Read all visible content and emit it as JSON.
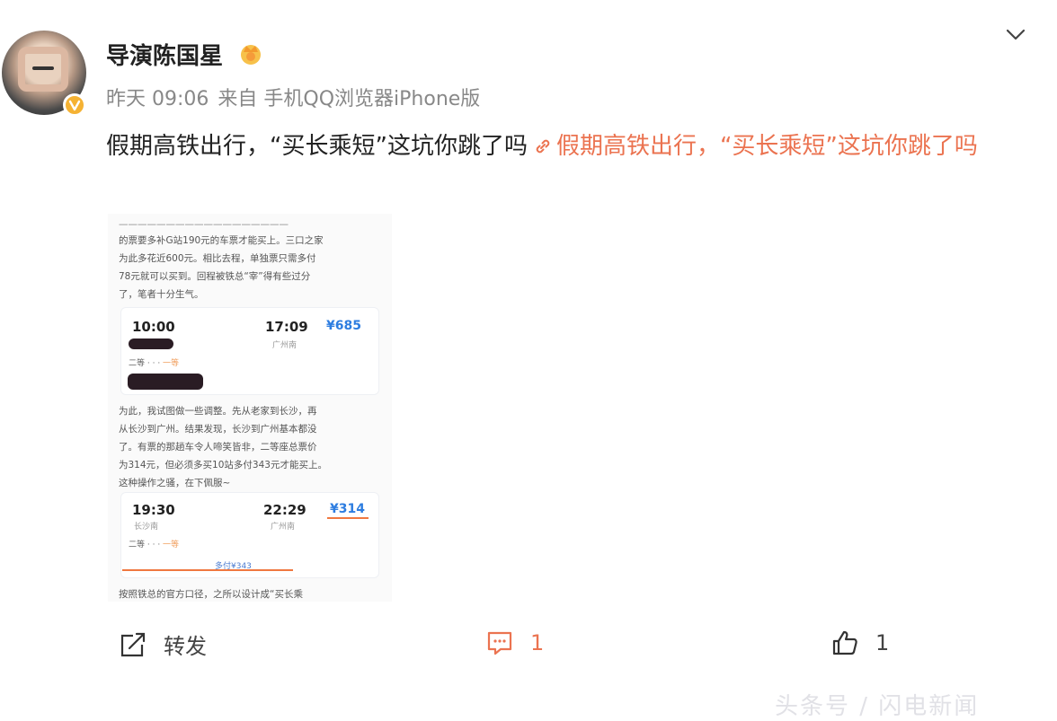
{
  "post": {
    "username": "导演陈国星",
    "time": "昨天 09:06",
    "source": "来自 手机QQ浏览器iPhone版",
    "text": "假期高铁出行，“买长乘短”这坑你跳了吗",
    "link_text": "假期高铁出行，“买长乘短”这坑你跳了吗"
  },
  "screenshot": {
    "para1": [
      "的票要多补G站190元的车票才能买上。三口之家",
      "为此多花近600元。相比去程，单独票只需多付",
      "78元就可以买到。回程被铁总“宰”得有些过分",
      "了，笔者十分生气。"
    ],
    "card1": {
      "depart": "10:00",
      "arrive": "17:09",
      "price": "¥685",
      "station": "广州南",
      "class1": "二等",
      "class2": "一等"
    },
    "para2": [
      "为此，我试图做一些调整。先从老家到长沙，再",
      "从长沙到广州。结果发现，长沙到广州基本都没",
      "了。有票的那趟车令人啼笑皆非，二等座总票价",
      "为314元，但必须多买10站多付343元才能买上。",
      "这种操作之骚，在下佩服~"
    ],
    "card2": {
      "depart": "19:30",
      "arrive": "22:29",
      "price": "¥314",
      "station": "广州南",
      "from_station": "长沙南",
      "class1": "二等",
      "class2": "一等",
      "note": "多付¥343"
    },
    "para3": "按照铁总的官方口径，之所以设计成“买长乘"
  },
  "actions": {
    "repost_label": "转发",
    "comment_count": "1",
    "like_count": "1"
  },
  "watermark": "头条号 / 闪电新闻",
  "colors": {
    "link": "#eb7350",
    "meta": "#888888",
    "verify": "#f5b233"
  },
  "icons": [
    "verified-icon",
    "crown-icon",
    "chevron-down-icon",
    "link-icon",
    "repost-icon",
    "comment-icon",
    "like-icon"
  ]
}
